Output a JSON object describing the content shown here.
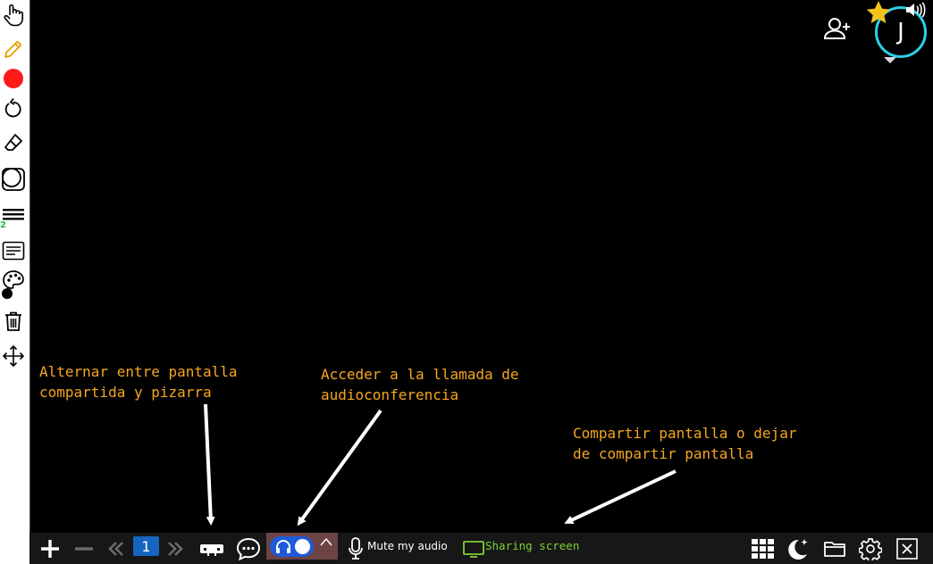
{
  "page": {
    "current": "1"
  },
  "annotations": {
    "toggle_view": "Alternar entre pantalla\ncompartida y pizarra",
    "audio_call": "Acceder a la llamada de\naudioconferencia",
    "share_screen": "Compartir pantalla o dejar\nde compartir pantalla"
  },
  "toolbar": {
    "thickness_value": "2",
    "icons": [
      "hand-pointer-icon",
      "pencil-icon",
      "record-color-icon",
      "undo-icon",
      "eraser-icon",
      "shape-icon",
      "line-thickness-icon",
      "text-icon",
      "palette-icon",
      "trash-icon",
      "move-icon"
    ]
  },
  "bottom_bar": {
    "mute_label": "Mute my audio",
    "sharing_label": "Sharing screen"
  },
  "user": {
    "avatar_initial": "J"
  },
  "colors": {
    "annotation": "#f5a623",
    "stage": "#000000",
    "bar": "#171717",
    "sharing": "#7fd037",
    "avatar_ring": "#2ad1e8",
    "page_badge": "#1565c0",
    "record": "#ff1a1a"
  }
}
